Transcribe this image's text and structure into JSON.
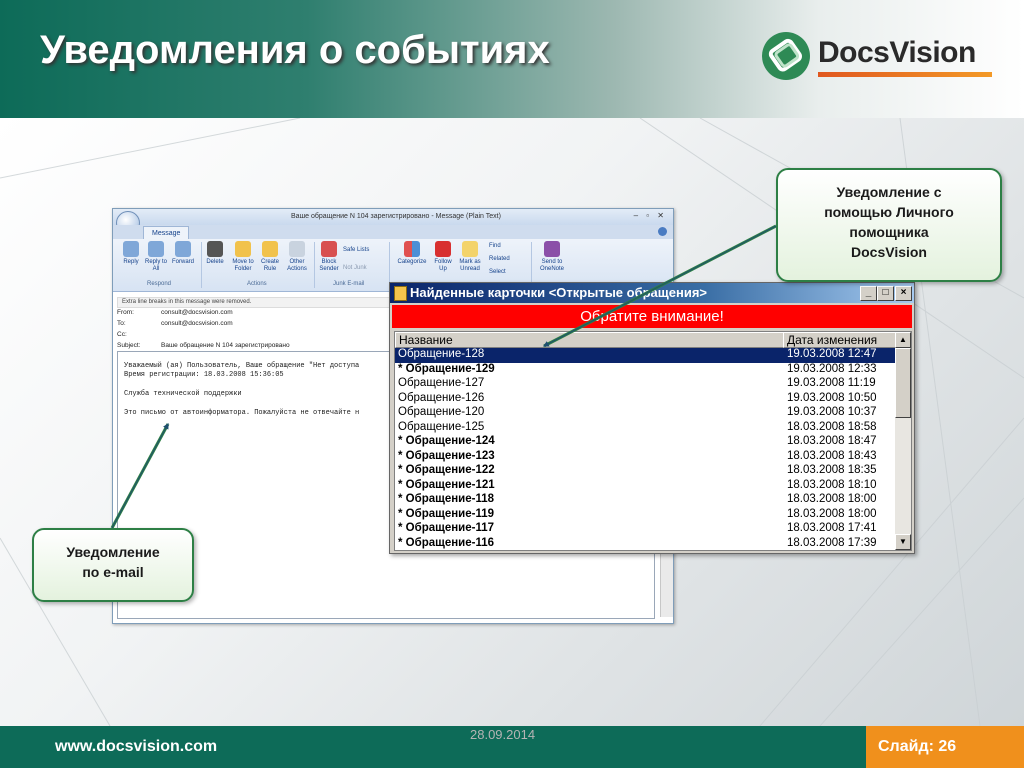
{
  "slide": {
    "title": "Уведомления о событиях",
    "logo": "DocsVision",
    "footer_url": "www.docsvision.com",
    "footer_date": "28.09.2014",
    "footer_slide": "Слайд: 26"
  },
  "outlook": {
    "window_title": "Ваше обращение N 104 зарегистрировано - Message (Plain Text)",
    "tab_message": "Message",
    "ribbon": {
      "reply": "Reply",
      "reply_all": "Reply to All",
      "forward": "Forward",
      "delete": "Delete",
      "move": "Move to Folder",
      "create_rule": "Create Rule",
      "other_actions": "Other Actions",
      "block_sender": "Block Sender",
      "safe_lists": "Safe Lists",
      "not_junk": "Not Junk",
      "categorize": "Categorize",
      "follow_up": "Follow Up",
      "mark_unread": "Mark as Unread",
      "find": "Find",
      "related": "Related",
      "select": "Select",
      "onenote": "Send to OneNote",
      "group_respond": "Respond",
      "group_actions": "Actions",
      "group_junk": "Junk E-mail"
    },
    "info_bar": "Extra line breaks in this message were removed.",
    "from_label": "From:",
    "from_value": "consult@docsvision.com",
    "to_label": "To:",
    "to_value": "consult@docsvision.com",
    "cc_label": "Cc:",
    "subject_label": "Subject:",
    "subject_value": "Ваше обращение N 104 зарегистрировано",
    "body": {
      "line1": "Уважаемый (ая) Пользователь, Ваше обращение \"Нет доступа",
      "line2": "Время регистрации: 18.03.2008 15:36:05",
      "line3": "Служба технической поддержки",
      "line4": "Это письмо от автоинформатора. Пожалуйста не отвечайте н"
    }
  },
  "cards_window": {
    "title": "Найденные карточки <Открытые обращения>",
    "alert": "Обратите внимание!",
    "col_name": "Название",
    "col_date": "Дата изменения",
    "rows": [
      {
        "name": "Обращение-128",
        "date": "19.03.2008 12:47"
      },
      {
        "name": "* Обращение-129",
        "date": "19.03.2008 12:33"
      },
      {
        "name": "Обращение-127",
        "date": "19.03.2008 11:19"
      },
      {
        "name": "Обращение-126",
        "date": "19.03.2008 10:50"
      },
      {
        "name": "Обращение-120",
        "date": "19.03.2008 10:37"
      },
      {
        "name": "Обращение-125",
        "date": "18.03.2008 18:58"
      },
      {
        "name": "* Обращение-124",
        "date": "18.03.2008 18:47"
      },
      {
        "name": "* Обращение-123",
        "date": "18.03.2008 18:43"
      },
      {
        "name": "* Обращение-122",
        "date": "18.03.2008 18:35"
      },
      {
        "name": "* Обращение-121",
        "date": "18.03.2008 18:10"
      },
      {
        "name": "* Обращение-118",
        "date": "18.03.2008 18:00"
      },
      {
        "name": "* Обращение-119",
        "date": "18.03.2008 18:00"
      },
      {
        "name": "* Обращение-117",
        "date": "18.03.2008 17:41"
      },
      {
        "name": "* Обращение-116",
        "date": "18.03.2008 17:39"
      }
    ]
  },
  "callouts": {
    "personal_line1": "Уведомление с",
    "personal_line2": "помощью Личного",
    "personal_line3": "помощника",
    "personal_line4": "DocsVision",
    "email_line1": "Уведомление",
    "email_line2": "по e-mail"
  },
  "colors": {
    "brand_green": "#0d6b58",
    "accent_orange": "#f0901c",
    "alert_red": "#ff0000",
    "selection": "#0a246a"
  }
}
